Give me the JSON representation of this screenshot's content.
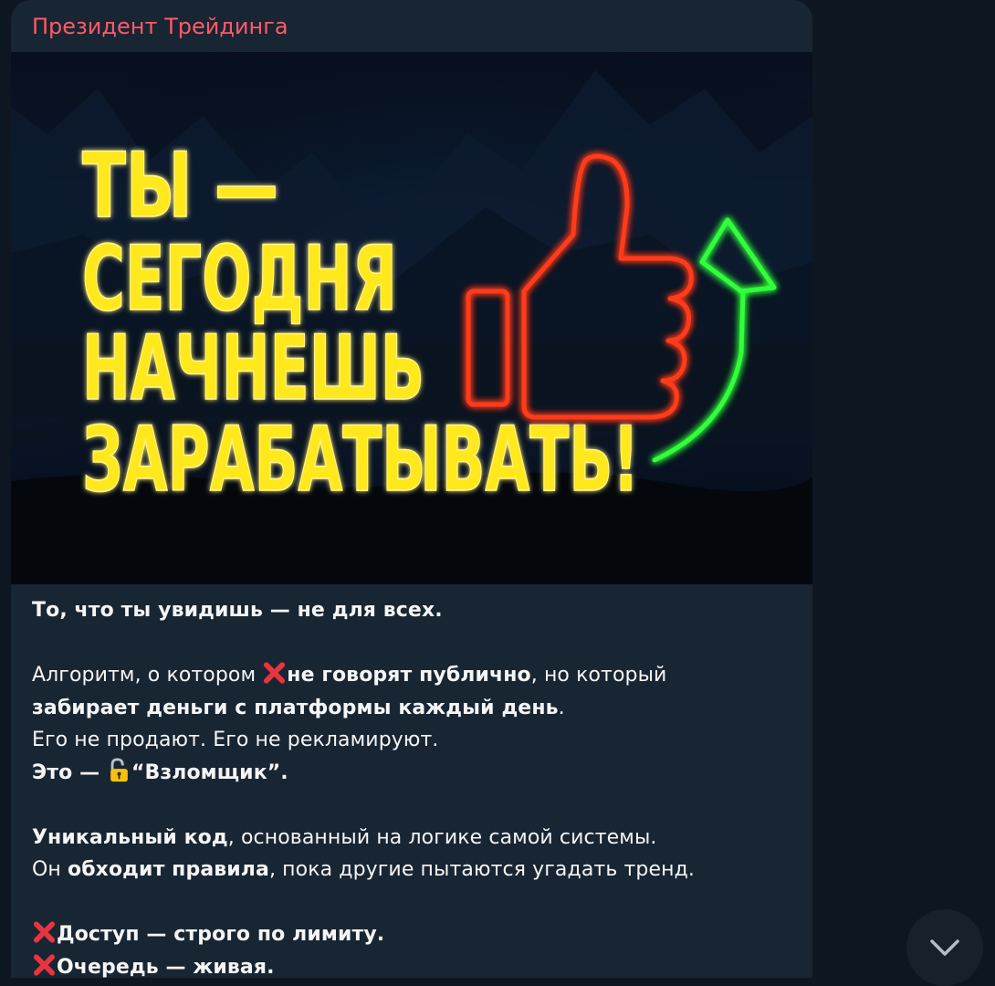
{
  "message": {
    "sender": "Президент Трейдинга",
    "image": {
      "headline_lines": [
        "ТЫ —",
        "СЕГОДНЯ",
        "НАЧНЕШЬ",
        "ЗАРАБАТЫВАТЬ!"
      ],
      "icons": [
        "thumbs-up-icon",
        "arrow-up-icon"
      ],
      "colors": {
        "headline": "#ffe81a",
        "thumb": "#ff3b1f",
        "arrow": "#33ff3a"
      }
    },
    "text": {
      "line1": "То, что ты увидишь — не для всех.",
      "p2_pre": "Алгоритм, о котором ",
      "p2_bold": "не говорят публично",
      "p2_post": ", но который",
      "p2_line2_bold": "забирает деньги с платформы каждый день",
      "p2_line2_post": ".",
      "p2_line3": "Его не продают. Его не рекламируют.",
      "p2_line4_pre": "Это — ",
      "p2_line4_post": "“Взломщик”.",
      "p3_bold1": "Уникальный код",
      "p3_post1": ", основанный на логике самой системы.",
      "p3_pre2": "Он ",
      "p3_bold2": "обходит правила",
      "p3_post2": ", пока другие пытаются угадать тренд.",
      "p4_line1": "Доступ — строго по лимиту.",
      "p4_line2": "Очередь — живая."
    }
  },
  "scroll_down": {
    "icon": "chevron-down-icon"
  }
}
